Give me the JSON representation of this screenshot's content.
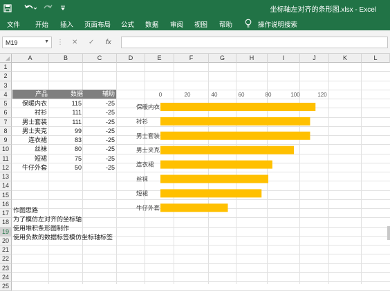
{
  "app": {
    "title": "坐标轴左对齐的条形图.xlsx  -  Excel",
    "ribbon_tabs": [
      "文件",
      "开始",
      "插入",
      "页面布局",
      "公式",
      "数据",
      "审阅",
      "视图",
      "帮助"
    ],
    "tell_me": "操作说明搜索"
  },
  "formula_bar": {
    "name_box": "M19",
    "formula": ""
  },
  "columns": [
    "A",
    "B",
    "C",
    "D",
    "E",
    "F",
    "G",
    "H",
    "I",
    "J",
    "K",
    "L"
  ],
  "rows": [
    "1",
    "2",
    "3",
    "4",
    "5",
    "6",
    "7",
    "8",
    "9",
    "10",
    "11",
    "12",
    "13",
    "14",
    "15",
    "16",
    "17",
    "18",
    "19",
    "20",
    "21",
    "22",
    "23",
    "24",
    "25"
  ],
  "selected_row": "19",
  "table": {
    "headers": [
      "产品",
      "数据",
      "辅助"
    ],
    "rows": [
      [
        "保暖内衣",
        "115",
        "-25"
      ],
      [
        "衬衫",
        "111",
        "-25"
      ],
      [
        "男士套装",
        "111",
        "-25"
      ],
      [
        "男士夹克",
        "99",
        "-25"
      ],
      [
        "连衣裙",
        "83",
        "-25"
      ],
      [
        "丝袜",
        "80",
        "-25"
      ],
      [
        "短裙",
        "75",
        "-25"
      ],
      [
        "牛仔外套",
        "50",
        "-25"
      ]
    ]
  },
  "notes": [
    "作图思路",
    "为了模仿左对齐的坐标轴",
    "使用堆积条形图制作",
    "使用负数的数据标签模仿坐标轴标签"
  ],
  "chart_data": {
    "type": "bar",
    "orientation": "horizontal",
    "categories": [
      "保暖内衣",
      "衬衫",
      "男士套装",
      "男士夹克",
      "连衣裙",
      "丝袜",
      "短裙",
      "牛仔外套"
    ],
    "values": [
      115,
      111,
      111,
      99,
      83,
      80,
      75,
      50
    ],
    "xlim": [
      0,
      120
    ],
    "xticks": [
      "0",
      "20",
      "40",
      "60",
      "80",
      "100",
      "120"
    ],
    "axis_position": "top",
    "gridlines": false,
    "bar_color": "#FFC000",
    "title": "",
    "xlabel": "",
    "ylabel": ""
  },
  "colors": {
    "excel_green": "#217346",
    "header_fill": "#7F7F7F"
  }
}
